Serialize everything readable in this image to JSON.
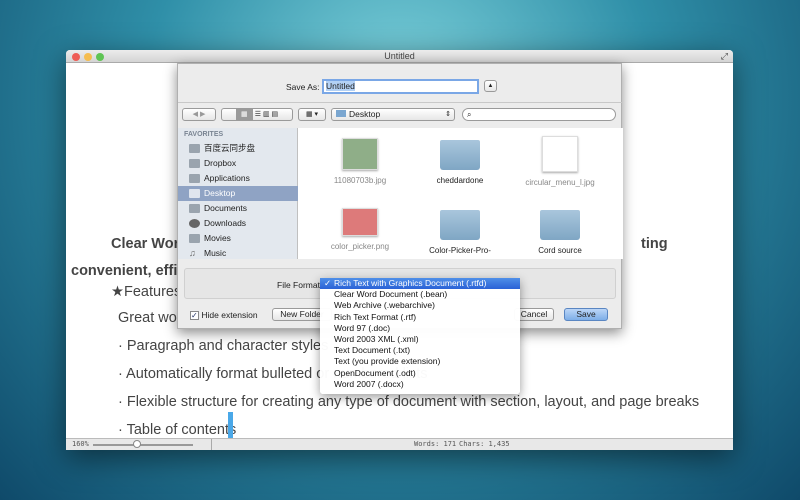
{
  "window": {
    "title": "Untitled"
  },
  "document": {
    "lines": [
      "Clear Word",
      "ting",
      "convenient, efficient and comfortable.",
      "★Features",
      "Great word processor",
      "· Paragraph and character styles",
      "· Automatically format bulleted or numbered lists",
      "· Flexible structure for creating any type of document with section, layout, and page breaks",
      "· Table of contents"
    ]
  },
  "status": {
    "zoom": "160%",
    "words": "Words: 171",
    "chars": "Chars: 1,435",
    "zoom_fraction": 0.4
  },
  "dialog": {
    "save_as_label": "Save As:",
    "save_as_value": "Untitled",
    "location": "Desktop",
    "search_placeholder": "",
    "sidebar_header": "FAVORITES",
    "sidebar": [
      {
        "label": "百度云同步盘"
      },
      {
        "label": "Dropbox"
      },
      {
        "label": "Applications"
      },
      {
        "label": "Desktop",
        "selected": true
      },
      {
        "label": "Documents"
      },
      {
        "label": "Downloads"
      },
      {
        "label": "Movies"
      },
      {
        "label": "Music"
      }
    ],
    "files": [
      {
        "name": "11080703b.jpg",
        "type": "image"
      },
      {
        "name": "cheddardone",
        "type": "folder"
      },
      {
        "name": "circular_menu_l.jpg",
        "type": "image"
      },
      {
        "name": "color_picker.png",
        "type": "image"
      },
      {
        "name": "Color-Picker-Pro-",
        "type": "folder"
      },
      {
        "name": "Cord source",
        "type": "folder"
      }
    ],
    "file_format_label": "File Format:",
    "hide_extension": "Hide extension",
    "hide_extension_checked": true,
    "new_folder": "New Folder",
    "cancel": "Cancel",
    "save": "Save"
  },
  "format_menu": {
    "checkmark": "✓",
    "items": [
      "Rich Text with Graphics Document (.rtfd)",
      "Clear Word Document (.bean)",
      "Web Archive (.webarchive)",
      "Rich Text Format (.rtf)",
      "Word 97 (.doc)",
      "Word 2003 XML (.xml)",
      "Text Document (.txt)",
      "Text (you provide extension)",
      "OpenDocument (.odt)",
      "Word 2007 (.docx)"
    ],
    "selected": 0
  }
}
